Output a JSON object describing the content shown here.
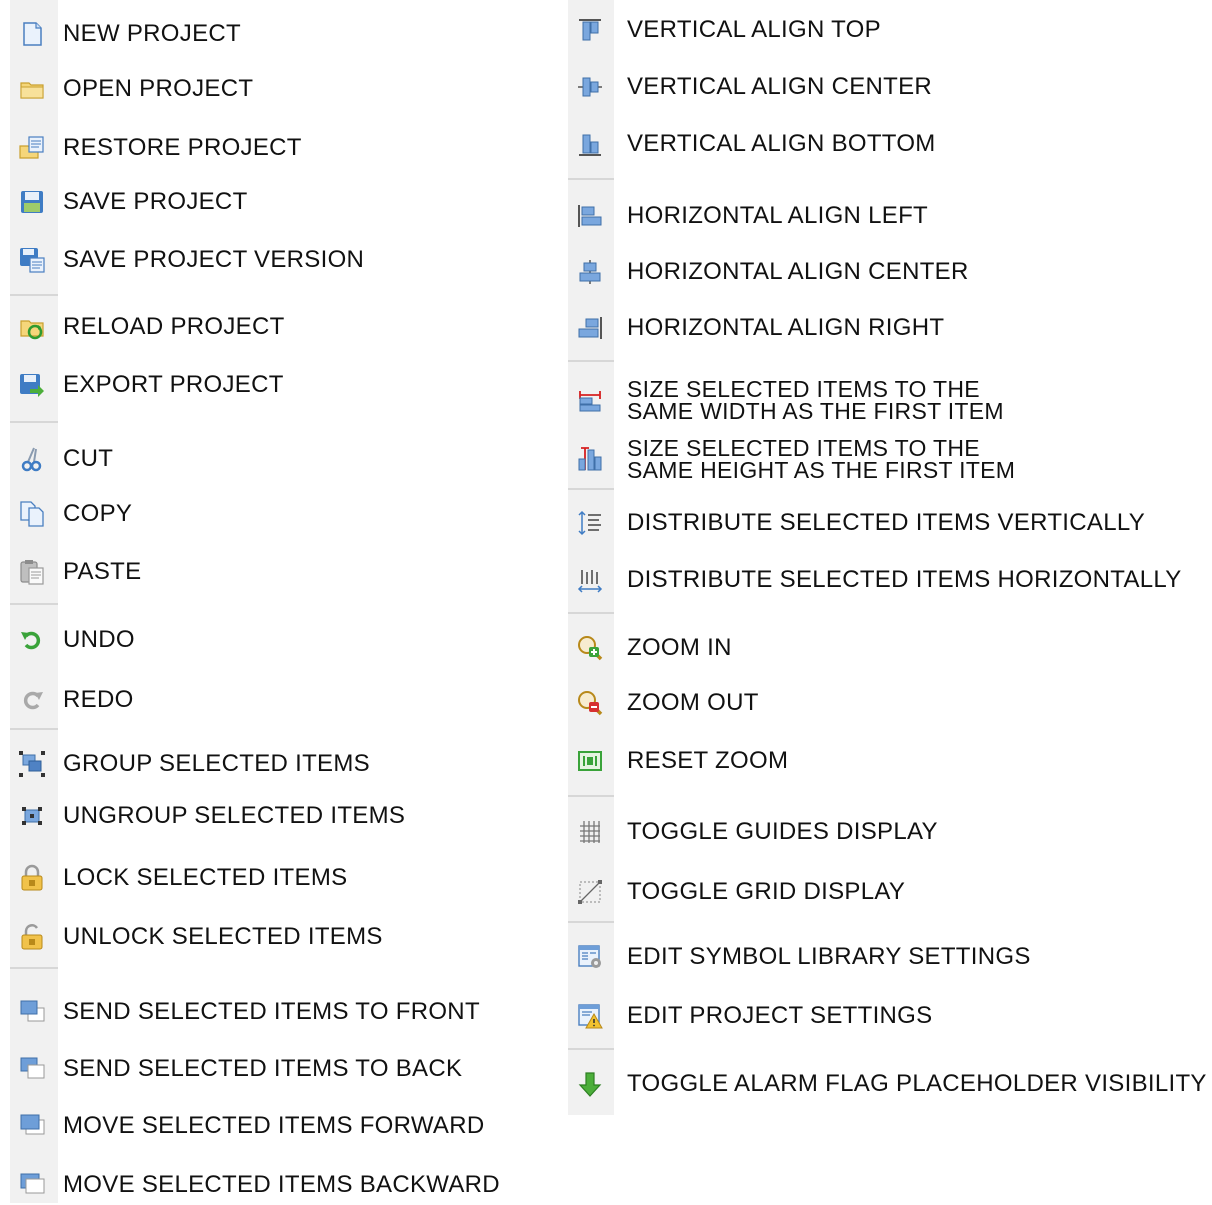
{
  "left": {
    "items": [
      {
        "label": "NEW PROJECT",
        "icon": "new-document-icon"
      },
      {
        "label": "OPEN PROJECT",
        "icon": "open-folder-icon"
      },
      {
        "label": "RESTORE PROJECT",
        "icon": "restore-icon"
      },
      {
        "label": "SAVE PROJECT",
        "icon": "save-icon"
      },
      {
        "label": "SAVE PROJECT VERSION",
        "icon": "save-version-icon"
      },
      {
        "label": "RELOAD PROJECT",
        "icon": "reload-icon"
      },
      {
        "label": "EXPORT PROJECT",
        "icon": "export-icon"
      },
      {
        "label": "CUT",
        "icon": "scissors-icon"
      },
      {
        "label": "COPY",
        "icon": "copy-icon"
      },
      {
        "label": "PASTE",
        "icon": "paste-icon"
      },
      {
        "label": "UNDO",
        "icon": "undo-icon"
      },
      {
        "label": "REDO",
        "icon": "redo-icon"
      },
      {
        "label": "GROUP SELECTED ITEMS",
        "icon": "group-icon"
      },
      {
        "label": "UNGROUP SELECTED ITEMS",
        "icon": "ungroup-icon"
      },
      {
        "label": "LOCK SELECTED ITEMS",
        "icon": "lock-icon"
      },
      {
        "label": "UNLOCK SELECTED ITEMS",
        "icon": "unlock-icon"
      },
      {
        "label": "SEND SELECTED ITEMS TO FRONT",
        "icon": "bring-to-front-icon"
      },
      {
        "label": "SEND SELECTED ITEMS TO BACK",
        "icon": "send-to-back-icon"
      },
      {
        "label": "MOVE SELECTED ITEMS FORWARD",
        "icon": "move-forward-icon"
      },
      {
        "label": "MOVE SELECTED ITEMS BACKWARD",
        "icon": "move-backward-icon"
      }
    ]
  },
  "right": {
    "items": [
      {
        "label": "VERTICAL ALIGN TOP",
        "icon": "align-top-icon"
      },
      {
        "label": "VERTICAL ALIGN CENTER",
        "icon": "align-vcenter-icon"
      },
      {
        "label": "VERTICAL ALIGN BOTTOM",
        "icon": "align-bottom-icon"
      },
      {
        "label": "HORIZONTAL ALIGN LEFT",
        "icon": "align-left-icon"
      },
      {
        "label": "HORIZONTAL ALIGN CENTER",
        "icon": "align-hcenter-icon"
      },
      {
        "label": "HORIZONTAL ALIGN RIGHT",
        "icon": "align-right-icon"
      },
      {
        "label": "SIZE SELECTED ITEMS TO THE SAME WIDTH AS THE FIRST ITEM",
        "line1": "SIZE SELECTED ITEMS TO THE",
        "line2": "SAME WIDTH AS THE FIRST ITEM",
        "icon": "same-width-icon"
      },
      {
        "label": "SIZE SELECTED ITEMS TO THE SAME HEIGHT AS THE FIRST ITEM",
        "line1": "SIZE SELECTED ITEMS TO THE",
        "line2": "SAME HEIGHT AS THE FIRST ITEM",
        "icon": "same-height-icon"
      },
      {
        "label": "DISTRIBUTE SELECTED ITEMS VERTICALLY",
        "icon": "distribute-vertical-icon"
      },
      {
        "label": "DISTRIBUTE SELECTED ITEMS HORIZONTALLY",
        "icon": "distribute-horizontal-icon"
      },
      {
        "label": "ZOOM IN",
        "icon": "zoom-in-icon"
      },
      {
        "label": "ZOOM OUT",
        "icon": "zoom-out-icon"
      },
      {
        "label": "RESET ZOOM",
        "icon": "reset-zoom-icon"
      },
      {
        "label": "TOGGLE GUIDES DISPLAY",
        "icon": "guides-icon"
      },
      {
        "label": "TOGGLE GRID DISPLAY",
        "icon": "grid-icon"
      },
      {
        "label": "EDIT SYMBOL LIBRARY SETTINGS",
        "icon": "symbol-library-settings-icon"
      },
      {
        "label": "EDIT PROJECT SETTINGS",
        "icon": "project-settings-icon"
      },
      {
        "label": "TOGGLE ALARM FLAG PLACEHOLDER VISIBILITY",
        "icon": "alarm-flag-arrow-icon"
      }
    ]
  }
}
